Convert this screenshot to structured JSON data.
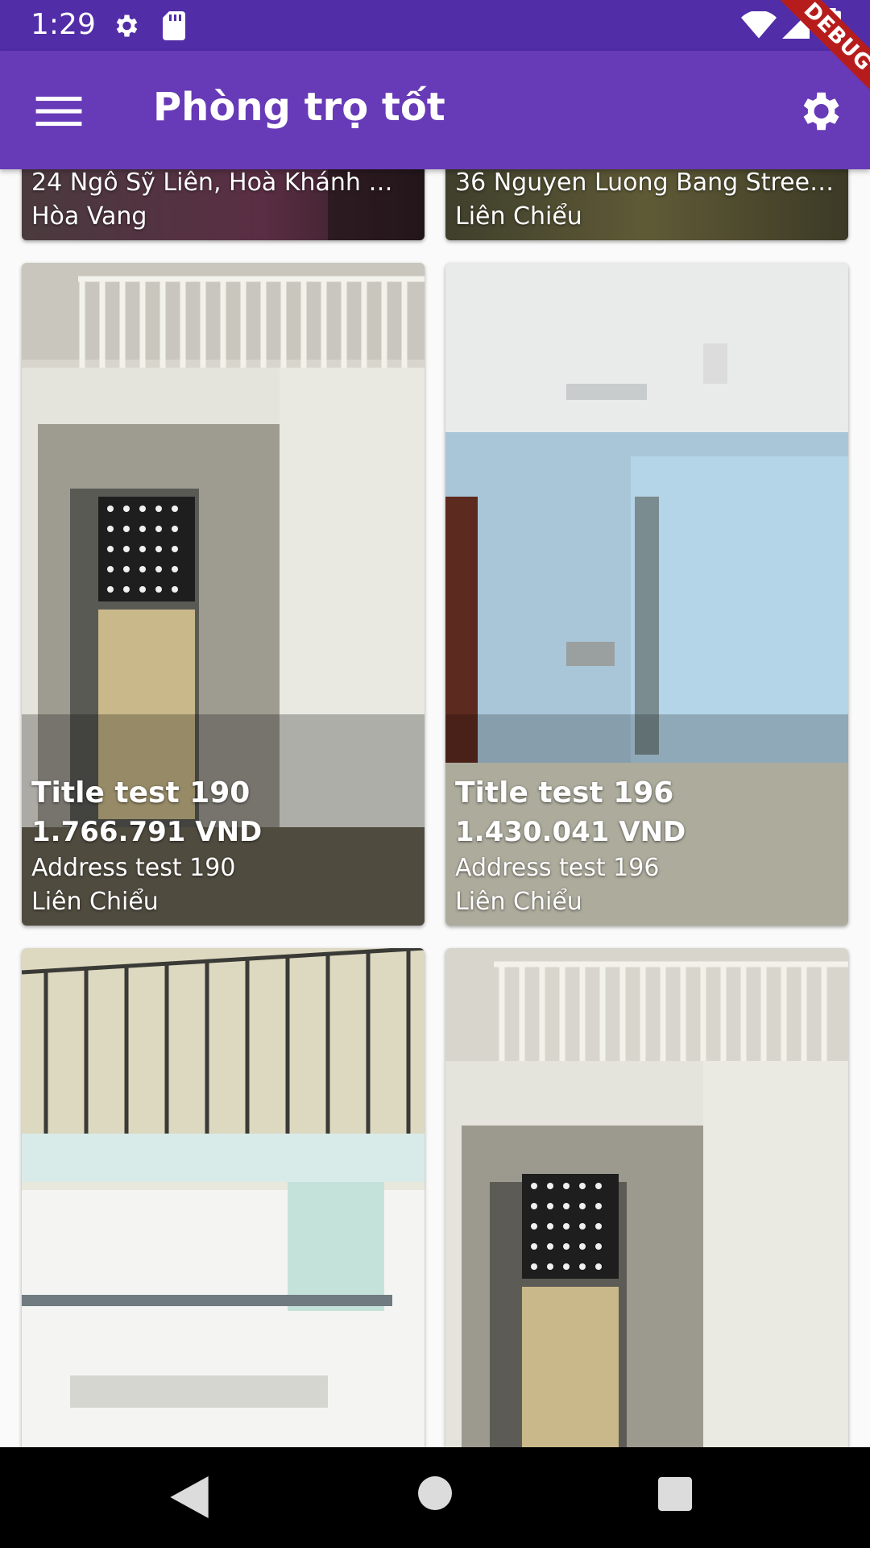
{
  "status_bar": {
    "time": "1:29"
  },
  "app_bar": {
    "title": "Phòng trọ tốt"
  },
  "debug_banner": "DEBUG",
  "listings": [
    {
      "address": "24 Ngô Sỹ Liên, Hoà Khánh …",
      "district": "Hòa Vang"
    },
    {
      "address": "36 Nguyen Luong Bang Stree…",
      "district": "Liên Chiểu"
    },
    {
      "title": "Title test 190",
      "price": "1.766.791 VND",
      "address": "Address test 190",
      "district": "Liên Chiểu"
    },
    {
      "title": "Title test 196",
      "price": "1.430.041 VND",
      "address": "Address test 196",
      "district": "Liên Chiểu"
    },
    {},
    {}
  ],
  "icons": {
    "status": [
      "gear-icon",
      "sd-card-icon",
      "wifi-icon",
      "signal-icon",
      "battery-icon"
    ],
    "app_bar": [
      "menu-icon",
      "settings-icon"
    ],
    "nav": [
      "back-icon",
      "home-icon",
      "recents-icon"
    ]
  },
  "colors": {
    "status_bar": "#512da8",
    "app_bar": "#673ab7",
    "debug_ribbon": "#b71c1c",
    "nav_bar": "#000000"
  }
}
